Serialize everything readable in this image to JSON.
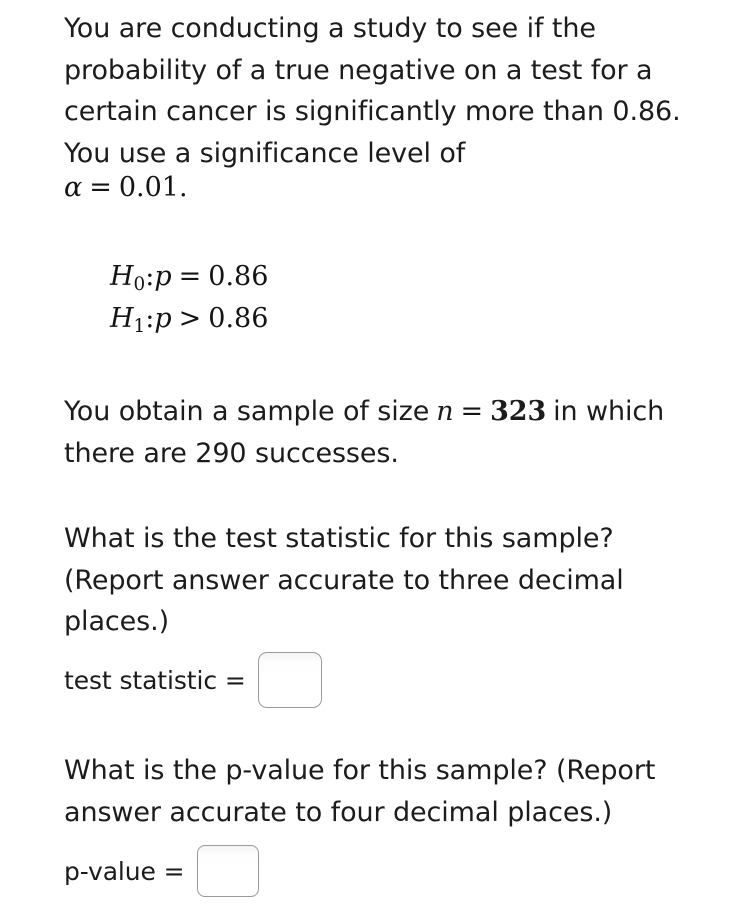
{
  "problem": {
    "intro": "You are conducting a study to see if the probability of a true negative on a test for a certain cancer is significantly more than 0.86. You use a significance level of",
    "alpha_symbol": "α",
    "alpha_equals": "=",
    "alpha_value": "0.01.",
    "hypotheses": {
      "null": {
        "symbol": "H",
        "subscript": "0",
        "colon": ":",
        "parameter": "p",
        "relation": "=",
        "value": "0.86"
      },
      "alternative": {
        "symbol": "H",
        "subscript": "1",
        "colon": ":",
        "parameter": "p",
        "relation": ">",
        "value": "0.86"
      }
    },
    "sample": {
      "text_before": "You obtain a sample of size",
      "n_symbol": "n",
      "n_relation": "=",
      "n_value": "323",
      "text_after": "in which there are 290 successes.",
      "sample_size": 323,
      "successes": 290
    },
    "question_test_statistic": "What is the test statistic for this sample? (Report answer accurate to three decimal places.)",
    "question_p_value": "What is the p-value for this sample? (Report answer accurate to four decimal places.)"
  },
  "answers": {
    "test_statistic": {
      "label": "test statistic =",
      "value": "",
      "placeholder": ""
    },
    "p_value": {
      "label": "p-value =",
      "value": "",
      "placeholder": ""
    }
  },
  "theme": {
    "background": "#ffffff",
    "text_color": "#1c1c1c",
    "input_border": "#9a9a9a"
  }
}
